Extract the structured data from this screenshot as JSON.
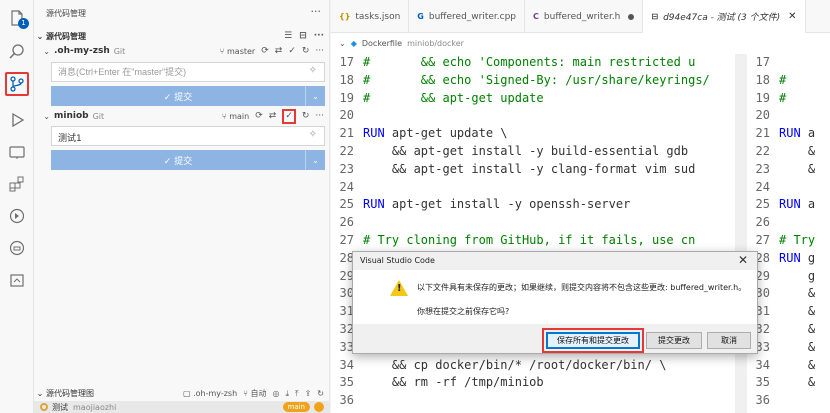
{
  "activity_bar": {
    "badge": "1",
    "icons": [
      "explorer-icon",
      "search-icon",
      "source-control-icon",
      "run-debug-icon",
      "remote-explorer-icon",
      "extensions-icon",
      "testing-icon",
      "docker-icon",
      "ports-icon"
    ]
  },
  "sidebar": {
    "title": "源代码管理",
    "section_title": "源代码管理",
    "repos": [
      {
        "name": ".oh-my-zsh",
        "kind": "Git",
        "branch": "master",
        "input_placeholder": "消息(Ctrl+Enter 在\"master\"提交)",
        "input_value": "",
        "commit_label": "✓ 提交"
      },
      {
        "name": "miniob",
        "kind": "Git",
        "branch": "main",
        "input_placeholder": "",
        "input_value": "测试1",
        "commit_label": "✓ 提交"
      }
    ],
    "graph": {
      "title": "源代码管理图",
      "repo_label": ".oh-my-zsh",
      "auto_label": "自动",
      "commit_message": "测试",
      "commit_author": "maojiaozhi",
      "branch_pill": "main"
    }
  },
  "tabs": [
    {
      "icon": "{}",
      "label": "tasks.json",
      "state": ""
    },
    {
      "icon": "G",
      "label": "buffered_writer.cpp",
      "state": ""
    },
    {
      "icon": "C",
      "label": "buffered_writer.h",
      "state": "modified"
    },
    {
      "icon": "⊟",
      "label": "d94e47ca - 测试 (3 个文件)",
      "state": "active"
    }
  ],
  "breadcrumb": [
    "Dockerfile",
    "miniob/docker"
  ],
  "code_left": [
    {
      "n": "17",
      "text": "#       && echo 'Components: main restricted u"
    },
    {
      "n": "18",
      "text": "#       && echo 'Signed-By: /usr/share/keyrings/"
    },
    {
      "n": "19",
      "text": "#       && apt-get update"
    },
    {
      "n": "20",
      "text": ""
    },
    {
      "n": "21",
      "text": "RUN apt-get update \\"
    },
    {
      "n": "22",
      "text": "    && apt-get install -y build-essential gdb"
    },
    {
      "n": "23",
      "text": "    && apt-get install -y clang-format vim sud"
    },
    {
      "n": "24",
      "text": ""
    },
    {
      "n": "25",
      "text": "RUN apt-get install -y openssh-server"
    },
    {
      "n": "26",
      "text": ""
    },
    {
      "n": "27",
      "text": "# Try cloning from GitHub, if it fails, use cn"
    },
    {
      "n": "28",
      "text": "RUN git clone https://github.com/oceanbase/min"
    },
    {
      "n": "29",
      "text": ""
    },
    {
      "n": "30",
      "text": ""
    },
    {
      "n": "31",
      "text": ""
    },
    {
      "n": "32",
      "text": ""
    },
    {
      "n": "33",
      "text": ""
    },
    {
      "n": "34",
      "text": "    && cp docker/bin/* /root/docker/bin/ \\"
    },
    {
      "n": "35",
      "text": "    && rm -rf /tmp/miniob"
    },
    {
      "n": "36",
      "text": ""
    }
  ],
  "code_right": [
    {
      "n": "17",
      "text": ""
    },
    {
      "n": "18",
      "text": "#"
    },
    {
      "n": "19",
      "text": "#"
    },
    {
      "n": "20",
      "text": ""
    },
    {
      "n": "21",
      "text": "RUN a"
    },
    {
      "n": "22",
      "text": "    &"
    },
    {
      "n": "23",
      "text": "    &"
    },
    {
      "n": "24",
      "text": ""
    },
    {
      "n": "25",
      "text": "RUN a"
    },
    {
      "n": "26",
      "text": ""
    },
    {
      "n": "27",
      "text": "# Try"
    },
    {
      "n": "28",
      "text": "RUN g"
    },
    {
      "n": "29",
      "text": "    g"
    },
    {
      "n": "30",
      "text": "    &"
    },
    {
      "n": "31",
      "text": "    &"
    },
    {
      "n": "32",
      "text": "    &"
    },
    {
      "n": "33",
      "text": "    &"
    },
    {
      "n": "34",
      "text": "    &"
    },
    {
      "n": "35",
      "text": "    &"
    },
    {
      "n": "36",
      "text": ""
    }
  ],
  "dialog": {
    "title": "Visual Studio Code",
    "message": "以下文件具有未保存的更改；如果继续，则提交内容将不包含这些更改: buffered_writer.h。",
    "question": "你想在提交之前保存它吗?",
    "buttons": {
      "save_and_commit": "保存所有和提交更改",
      "commit": "提交更改",
      "cancel": "取消"
    }
  },
  "colors": {
    "accent": "#005fb8",
    "highlight": "#e53935",
    "commit_button": "#8db4e2",
    "branch_pill": "#f0a31a"
  }
}
